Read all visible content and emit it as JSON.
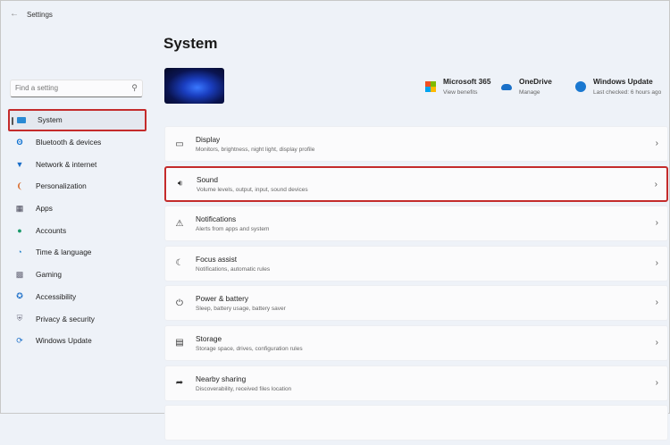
{
  "window": {
    "title": "Settings",
    "back_icon": "back-arrow-icon"
  },
  "search": {
    "placeholder": "Find a setting"
  },
  "sidebar": {
    "items": [
      {
        "label": "System",
        "icon": "system-icon",
        "selected": true
      },
      {
        "label": "Bluetooth & devices",
        "icon": "bluetooth-icon"
      },
      {
        "label": "Network & internet",
        "icon": "wifi-icon"
      },
      {
        "label": "Personalization",
        "icon": "brush-icon"
      },
      {
        "label": "Apps",
        "icon": "apps-icon"
      },
      {
        "label": "Accounts",
        "icon": "person-icon"
      },
      {
        "label": "Time & language",
        "icon": "globe-icon"
      },
      {
        "label": "Gaming",
        "icon": "gamepad-icon"
      },
      {
        "label": "Accessibility",
        "icon": "accessibility-icon"
      },
      {
        "label": "Privacy & security",
        "icon": "shield-icon"
      },
      {
        "label": "Windows Update",
        "icon": "update-icon"
      }
    ]
  },
  "main": {
    "title": "System",
    "tiles": [
      {
        "title": "Microsoft 365",
        "subtitle": "View benefits"
      },
      {
        "title": "OneDrive",
        "subtitle": "Manage"
      },
      {
        "title": "Windows Update",
        "subtitle": "Last checked: 6 hours ago"
      }
    ],
    "rows": [
      {
        "title": "Display",
        "subtitle": "Monitors, brightness, night light, display profile"
      },
      {
        "title": "Sound",
        "subtitle": "Volume levels, output, input, sound devices"
      },
      {
        "title": "Notifications",
        "subtitle": "Alerts from apps and system"
      },
      {
        "title": "Focus assist",
        "subtitle": "Notifications, automatic rules"
      },
      {
        "title": "Power & battery",
        "subtitle": "Sleep, battery usage, battery saver"
      },
      {
        "title": "Storage",
        "subtitle": "Storage space, drives, configuration rules"
      },
      {
        "title": "Nearby sharing",
        "subtitle": "Discoverability, received files location"
      }
    ]
  },
  "colors": {
    "highlight": "#c42b2b",
    "accent": "#0067c0"
  }
}
